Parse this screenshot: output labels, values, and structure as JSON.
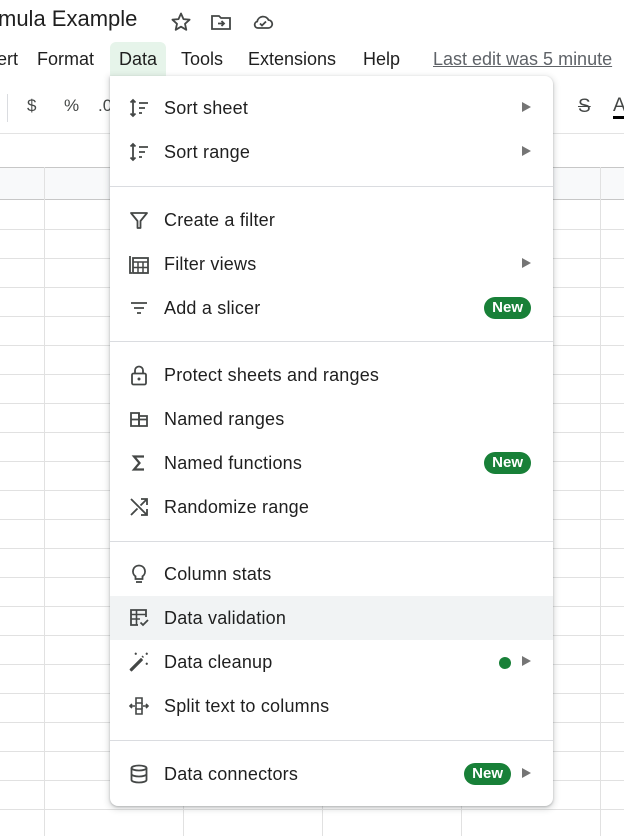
{
  "titlebar": {
    "doc_title": "mula Example",
    "icons": [
      "star-icon",
      "move-to-folder-icon",
      "cloud-saved-icon"
    ]
  },
  "menubar": {
    "items": [
      {
        "label": "ert"
      },
      {
        "label": "Format"
      },
      {
        "label": "Data",
        "active": true
      },
      {
        "label": "Tools"
      },
      {
        "label": "Extensions"
      },
      {
        "label": "Help"
      }
    ],
    "last_edit": "Last edit was 5 minute"
  },
  "toolbar": {
    "currency": "$",
    "percent": "%",
    "decimal": ".0",
    "strikethrough": "S",
    "text_color": "A"
  },
  "data_menu": {
    "items": [
      {
        "label": "Sort sheet",
        "icon": "sort-icon",
        "submenu": true
      },
      {
        "label": "Sort range",
        "icon": "sort-icon",
        "submenu": true
      },
      {
        "label": "Create a filter",
        "icon": "filter-icon"
      },
      {
        "label": "Filter views",
        "icon": "filter-views-icon",
        "submenu": true
      },
      {
        "label": "Add a slicer",
        "icon": "slicer-icon",
        "badge": "New"
      },
      {
        "label": "Protect sheets and ranges",
        "icon": "lock-icon"
      },
      {
        "label": "Named ranges",
        "icon": "named-ranges-icon"
      },
      {
        "label": "Named functions",
        "icon": "sigma-icon",
        "badge": "New"
      },
      {
        "label": "Randomize range",
        "icon": "shuffle-icon"
      },
      {
        "label": "Column stats",
        "icon": "lightbulb-icon"
      },
      {
        "label": "Data validation",
        "icon": "data-validation-icon",
        "hovered": true
      },
      {
        "label": "Data cleanup",
        "icon": "magic-wand-icon",
        "submenu": true,
        "dot": true
      },
      {
        "label": "Split text to columns",
        "icon": "split-columns-icon"
      },
      {
        "label": "Data connectors",
        "icon": "database-icon",
        "submenu": true,
        "badge": "New"
      }
    ]
  },
  "colors": {
    "badge_green": "#188038",
    "hover_bg": "#f1f3f4",
    "active_menu_bg": "#e6f4ea"
  }
}
